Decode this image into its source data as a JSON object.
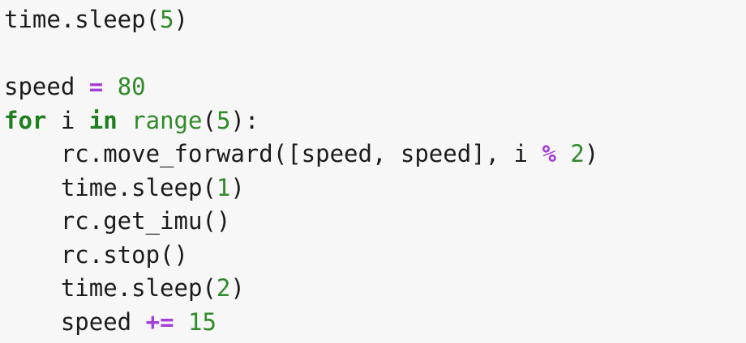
{
  "colors": {
    "background": "#f7f7f7",
    "text": "#1b1b1b",
    "keyword": "#1d7f1d",
    "number": "#2f8a2a",
    "builtin": "#2f8a2a",
    "operator": "#a43ed8"
  },
  "code": {
    "lines": [
      {
        "tokens": [
          {
            "t": "time.sleep(",
            "k": "plain"
          },
          {
            "t": "5",
            "k": "num"
          },
          {
            "t": ")",
            "k": "plain"
          }
        ]
      },
      {
        "tokens": []
      },
      {
        "tokens": [
          {
            "t": "speed ",
            "k": "plain"
          },
          {
            "t": "=",
            "k": "op"
          },
          {
            "t": " ",
            "k": "plain"
          },
          {
            "t": "80",
            "k": "num"
          }
        ]
      },
      {
        "tokens": [
          {
            "t": "for",
            "k": "kw"
          },
          {
            "t": " i ",
            "k": "plain"
          },
          {
            "t": "in",
            "k": "kw"
          },
          {
            "t": " ",
            "k": "plain"
          },
          {
            "t": "range",
            "k": "builtin"
          },
          {
            "t": "(",
            "k": "plain"
          },
          {
            "t": "5",
            "k": "num"
          },
          {
            "t": "):",
            "k": "plain"
          }
        ]
      },
      {
        "tokens": [
          {
            "t": "    rc.move_forward([speed, speed], i ",
            "k": "plain"
          },
          {
            "t": "%",
            "k": "op"
          },
          {
            "t": " ",
            "k": "plain"
          },
          {
            "t": "2",
            "k": "num"
          },
          {
            "t": ")",
            "k": "plain"
          }
        ]
      },
      {
        "tokens": [
          {
            "t": "    time.sleep(",
            "k": "plain"
          },
          {
            "t": "1",
            "k": "num"
          },
          {
            "t": ")",
            "k": "plain"
          }
        ]
      },
      {
        "tokens": [
          {
            "t": "    rc.get_imu()",
            "k": "plain"
          }
        ]
      },
      {
        "tokens": [
          {
            "t": "    rc.stop()",
            "k": "plain"
          }
        ]
      },
      {
        "tokens": [
          {
            "t": "    time.sleep(",
            "k": "plain"
          },
          {
            "t": "2",
            "k": "num"
          },
          {
            "t": ")",
            "k": "plain"
          }
        ]
      },
      {
        "tokens": [
          {
            "t": "    speed ",
            "k": "plain"
          },
          {
            "t": "+=",
            "k": "op"
          },
          {
            "t": " ",
            "k": "plain"
          },
          {
            "t": "15",
            "k": "num"
          }
        ]
      }
    ]
  }
}
